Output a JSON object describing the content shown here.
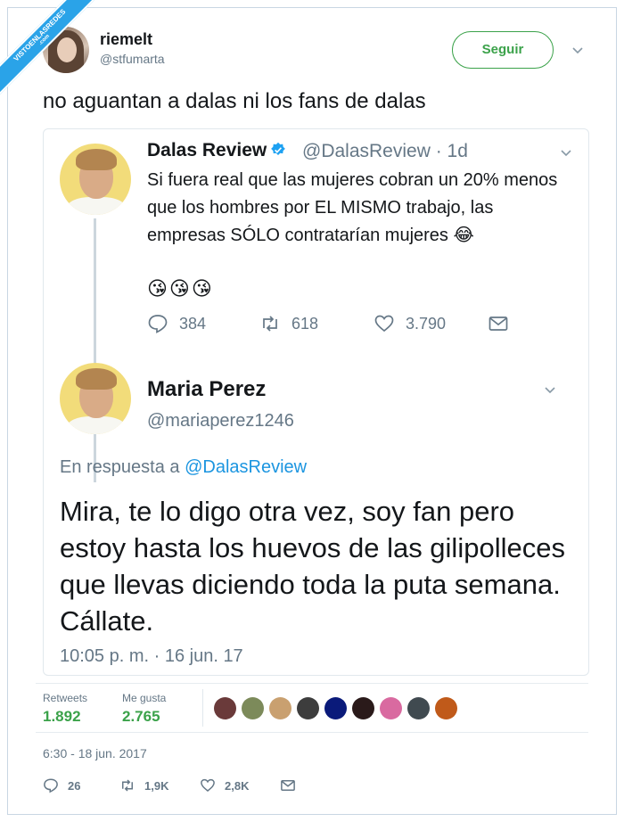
{
  "watermark": {
    "text": "VISTOENLASREDES",
    "sub": ".com"
  },
  "main_tweet": {
    "user": {
      "name": "riemelt",
      "handle": "@stfumarta"
    },
    "follow_label": "Seguir",
    "text": "no aguantan a dalas ni los fans de dalas",
    "timestamp": "6:30 - 18 jun. 2017",
    "stats": {
      "retweets_label": "Retweets",
      "retweets_value": "1.892",
      "likes_label": "Me gusta",
      "likes_value": "2.765"
    },
    "liker_avatars": [
      "#6a3a3a",
      "#7c8a5a",
      "#c9a070",
      "#3d3d3d",
      "#0a1a7a",
      "#2a1a1a",
      "#d96aa0",
      "#404a50",
      "#c05a1a"
    ],
    "actions": {
      "replies": "26",
      "retweets": "1,9K",
      "likes": "2,8K"
    }
  },
  "quoted_thread": {
    "original": {
      "name": "Dalas Review",
      "handle_time": "@DalasReview · 1d",
      "text": "Si fuera real que las mujeres cobran un 20% menos que los hombres por EL MISMO trabajo, las empresas SÓLO contratarían mujeres 😂",
      "emojis": "😘😘😘",
      "replies": "384",
      "retweets": "618",
      "likes": "3.790"
    },
    "reply": {
      "name": "Maria Perez",
      "handle": "@mariaperez1246",
      "reply_prefix": "En respuesta a",
      "reply_mention": "@DalasReview",
      "text": "Mira, te lo digo otra vez, soy fan pero estoy hasta los huevos de las gilipolleces que llevas diciendo toda la puta semana. Cállate.",
      "time": "10:05 p. m. · 16 jun. 17"
    }
  },
  "colors": {
    "accent_green": "#3ba24a",
    "link_blue": "#1b95e0",
    "muted": "#657786"
  }
}
